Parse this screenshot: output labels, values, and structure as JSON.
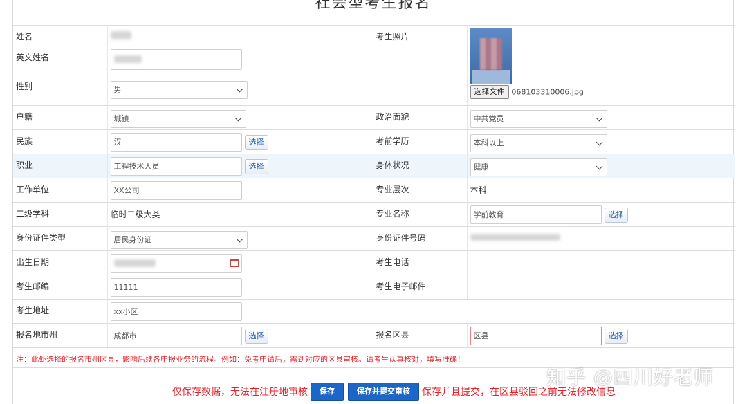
{
  "page": {
    "title": "社会型考生报名"
  },
  "fields": {
    "name": {
      "label": "姓名"
    },
    "english_name": {
      "label": "英文姓名"
    },
    "gender": {
      "label": "性别",
      "value": "男"
    },
    "photo": {
      "label": "考生照片",
      "file_button": "选择文件",
      "file_name": "068103310006.jpg"
    },
    "household": {
      "label": "户籍",
      "value": "城镇"
    },
    "political": {
      "label": "政治面貌",
      "value": "中共党员"
    },
    "ethnicity": {
      "label": "民族",
      "value": "汉",
      "pick": "选择"
    },
    "education": {
      "label": "考前学历",
      "value": "本科以上"
    },
    "occupation": {
      "label": "职业",
      "value": "工程技术人员",
      "pick": "选择"
    },
    "health": {
      "label": "身体状况",
      "value": "健康"
    },
    "employer": {
      "label": "工作单位",
      "value": "XX公司"
    },
    "level": {
      "label": "专业层次",
      "value": "本科"
    },
    "subject": {
      "label": "二级学科",
      "value": "临时二级大类"
    },
    "major": {
      "label": "专业名称",
      "value": "学前教育",
      "pick": "选择"
    },
    "id_type": {
      "label": "身份证件类型",
      "value": "居民身份证"
    },
    "id_number": {
      "label": "身份证件号码"
    },
    "birth": {
      "label": "出生日期"
    },
    "phone": {
      "label": "考生电话"
    },
    "postcode": {
      "label": "考生邮编",
      "value": "11111"
    },
    "email": {
      "label": "考生电子邮件"
    },
    "address": {
      "label": "考生地址",
      "value": "xx小区"
    },
    "city": {
      "label": "报名地市州",
      "value": "成都市",
      "pick": "选择"
    },
    "county": {
      "label": "报名区县",
      "value": "区县",
      "pick": "选择"
    }
  },
  "notice": "注：此处选择的报名市州区县，影响后续各申报业务的流程。例如：免考申请后，需到对应的区县审核。请考生认真核对，填写准确！",
  "actions": {
    "save_hint": "仅保存数据，无法在注册地审核",
    "save_label": "保存",
    "submit_label": "保存并提交审核",
    "submit_hint": "保存并且提交，在区县驳回之前无法修改信息"
  },
  "watermark": "知乎 @四川好老师",
  "colors": {
    "accent_blue": "#1c66c7",
    "warning_red": "#e4232b",
    "row_highlight": "#eef6fc"
  }
}
